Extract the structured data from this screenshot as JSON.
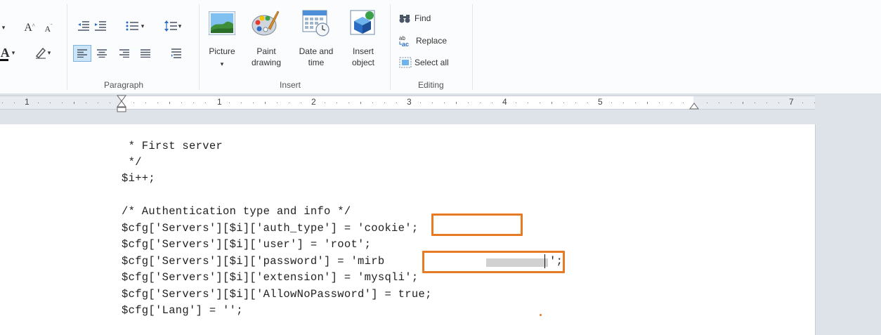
{
  "ribbon": {
    "font": {
      "grow_label": "A",
      "shrink_label": "A",
      "font_color_label": "A"
    },
    "paragraph": {
      "group_label": "Paragraph"
    },
    "insert": {
      "group_label": "Insert",
      "picture_label": "Picture",
      "picture_dropdown": "▾",
      "paint_label_line1": "Paint",
      "paint_label_line2": "drawing",
      "datetime_label_line1": "Date and",
      "datetime_label_line2": "time",
      "object_label_line1": "Insert",
      "object_label_line2": "object"
    },
    "editing": {
      "group_label": "Editing",
      "find_label": "Find",
      "replace_label": "Replace",
      "select_all_label": "Select all"
    }
  },
  "ruler": {
    "numbers": [
      "1",
      "1",
      "2",
      "3",
      "4",
      "5",
      "7"
    ]
  },
  "document": {
    "lines": [
      " * First server",
      " */",
      "$i++;",
      "",
      "/* Authentication type and info */",
      "$cfg['Servers'][$i]['auth_type'] = 'cookie';",
      "$cfg['Servers'][$i]['user'] = 'root';",
      "$cfg['Servers'][$i]['password'] = 'mirb",
      "$cfg['Servers'][$i]['extension'] = 'mysqli';",
      "$cfg['Servers'][$i]['AllowNoPassword'] = true;",
      "$cfg['Lang'] = '';"
    ],
    "password_tail": "';"
  },
  "colors": {
    "highlight": "#e67a25",
    "ribbon_bg": "#fbfcfd",
    "workspace_bg": "#dee3ea"
  }
}
